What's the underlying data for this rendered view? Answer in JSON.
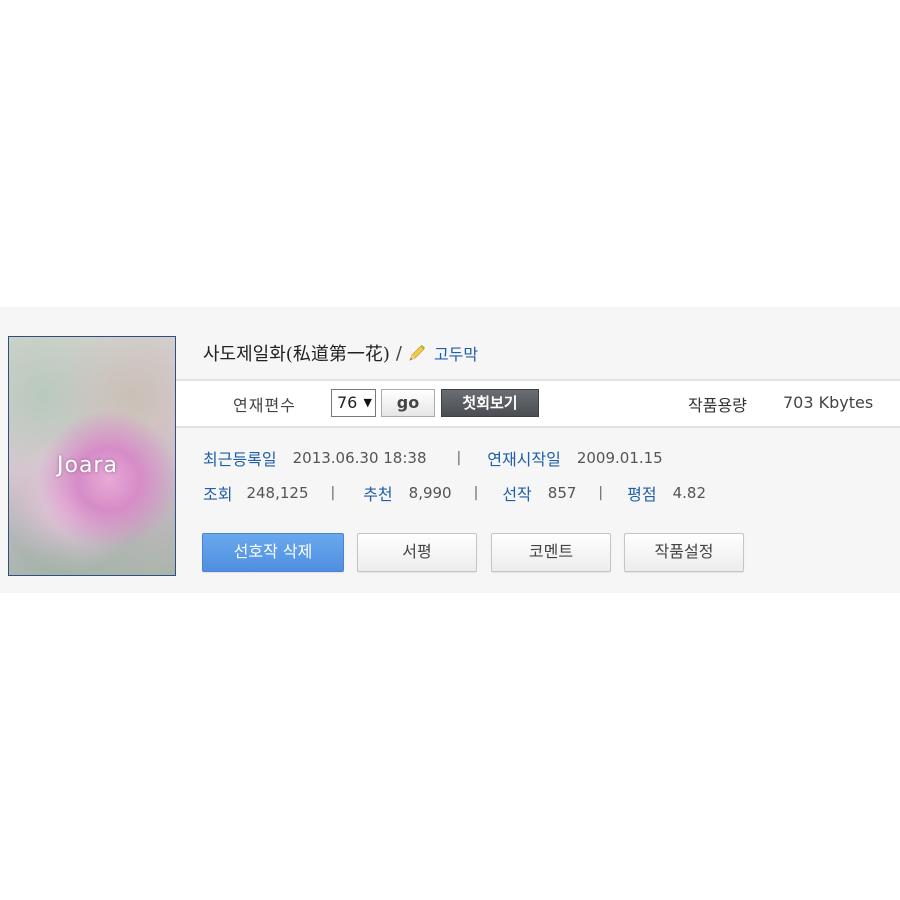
{
  "cover": {
    "logo": "Joara"
  },
  "work": {
    "title": "사도제일화(私道第一花)",
    "separator": "/",
    "author": "고두막"
  },
  "chapters": {
    "label": "연재편수",
    "selected": "76",
    "go_label": "go",
    "first_label": "첫회보기"
  },
  "size": {
    "label": "작품용량",
    "value": "703 Kbytes"
  },
  "stats": {
    "last_updated_label": "최근등록일",
    "last_updated_value": "2013.06.30 18:38",
    "start_label": "연재시작일",
    "start_value": "2009.01.15",
    "views_label": "조회",
    "views_value": "248,125",
    "recommend_label": "추천",
    "recommend_value": "8,990",
    "favorites_label": "선작",
    "favorites_value": "857",
    "rating_label": "평점",
    "rating_value": "4.82",
    "sep": "|"
  },
  "buttons": {
    "remove_favorite": "선호작 삭제",
    "review": "서평",
    "comment": "코멘트",
    "settings": "작품설정"
  },
  "colors": {
    "link": "#1f5fa9",
    "primary_button": "#4f8fe0",
    "dark_button": "#4a4d52"
  },
  "icons": {
    "pencil": "pencil-icon"
  }
}
